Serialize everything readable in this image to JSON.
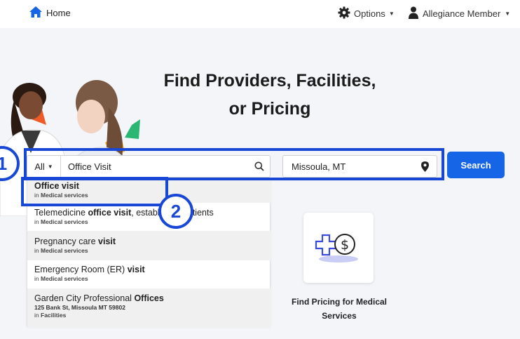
{
  "nav": {
    "home_label": "Home",
    "options_label": "Options",
    "member_label": "Allegiance Member"
  },
  "hero": {
    "title_line1": "Find Providers, Facilities,",
    "title_line2": "or Pricing"
  },
  "search": {
    "category": "All",
    "query": "Office Visit",
    "location": "Missoula, MT",
    "button_label": "Search"
  },
  "annotations": {
    "badge1": "1",
    "badge2": "2"
  },
  "suggestions": [
    {
      "pre": "",
      "bold": "Office visit",
      "post": "",
      "in_label": "in",
      "category": "Medical services",
      "address": ""
    },
    {
      "pre": "Telemedicine ",
      "bold": "office visit",
      "post": ", established patients",
      "in_label": "in",
      "category": "Medical services",
      "address": ""
    },
    {
      "pre": "Pregnancy care ",
      "bold": "visit",
      "post": "",
      "in_label": "in",
      "category": "Medical services",
      "address": ""
    },
    {
      "pre": "Emergency Room (ER) ",
      "bold": "visit",
      "post": "",
      "in_label": "in",
      "category": "Medical services",
      "address": ""
    },
    {
      "pre": "Garden City Professional ",
      "bold": "Offices",
      "post": "",
      "in_label": "in",
      "category": "Facilities",
      "address": "125 Bank St, Missoula MT 59802"
    }
  ],
  "pricing_card": {
    "label_line1": "Find Pricing for Medical",
    "label_line2": "Services"
  },
  "colors": {
    "brand_blue": "#1565e6",
    "annotation_blue": "#1847d6"
  }
}
